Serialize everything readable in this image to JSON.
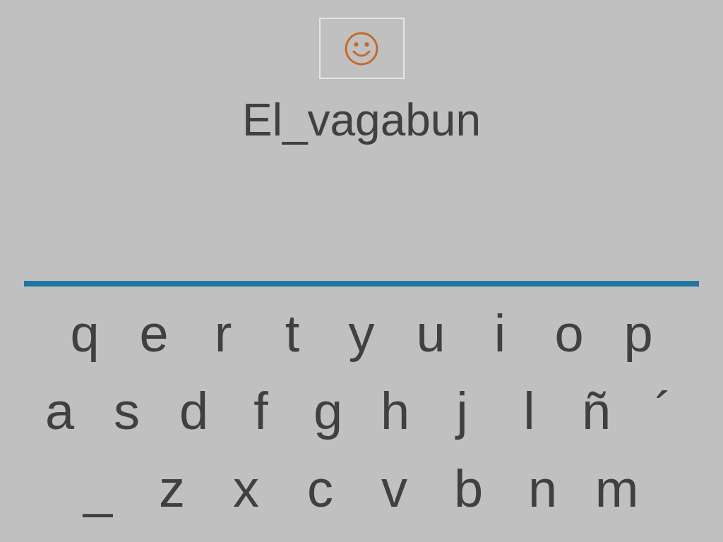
{
  "hint_box": {
    "kind": "smiley"
  },
  "word": "El_vagabun",
  "keyboard": {
    "rows": [
      [
        "q",
        "e",
        "r",
        "t",
        "y",
        "u",
        "i",
        "o",
        "p"
      ],
      [
        "a",
        "s",
        "d",
        "f",
        "g",
        "h",
        "j",
        "l",
        "ñ",
        "´"
      ],
      [
        "_",
        "z",
        "x",
        "c",
        "v",
        "b",
        "n",
        "m"
      ]
    ]
  }
}
